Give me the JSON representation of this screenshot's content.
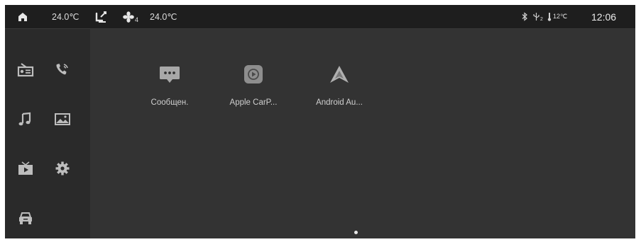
{
  "status": {
    "temp_left": "24.0℃",
    "fan_level": "4",
    "temp_right": "24.0℃",
    "usb_sub": "2",
    "outside_temp": "12℃",
    "time": "12:06"
  },
  "sidebar": {
    "items": [
      {
        "icon": "radio-icon"
      },
      {
        "icon": "phone-icon"
      },
      {
        "icon": "music-icon"
      },
      {
        "icon": "gallery-icon"
      },
      {
        "icon": "video-icon"
      },
      {
        "icon": "settings-gear-icon"
      },
      {
        "icon": "car-icon"
      }
    ]
  },
  "apps": [
    {
      "label": "Сообщен.",
      "icon": "messages-icon"
    },
    {
      "label": "Apple CarP...",
      "icon": "apple-carplay-icon"
    },
    {
      "label": "Android Au...",
      "icon": "android-auto-icon"
    }
  ],
  "colors": {
    "background": "#2f2f2f",
    "statusbar": "#1e1e1e",
    "sidebar": "#2a2a2a",
    "text": "#dcdcdc"
  }
}
